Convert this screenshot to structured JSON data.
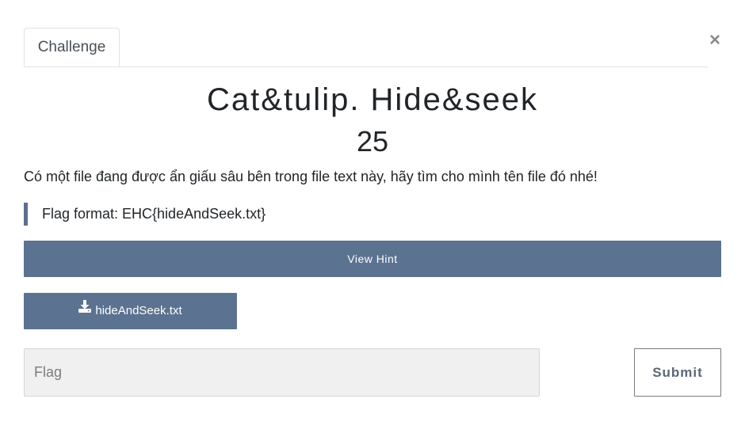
{
  "tabs": [
    {
      "label": "Challenge",
      "active": true
    }
  ],
  "close": {
    "symbol": "×"
  },
  "challenge": {
    "name": "Cat&tulip. Hide&seek",
    "points": "25",
    "description": "Có một file đang được ẩn giấu sâu bên trong file text này, hãy tìm cho mình tên file đó nhé!",
    "flag_format": "Flag format: EHC{hideAndSeek.txt}"
  },
  "buttons": {
    "hint_label": "View Hint",
    "file_label": "hideAndSeek.txt",
    "file_icon": "download-icon",
    "submit_label": "Submit"
  },
  "flag_input": {
    "value": "",
    "placeholder": "Flag"
  },
  "colors": {
    "button_bg": "#5b7290",
    "quote_bar": "#5c6f8e",
    "input_bg": "#f0f0f0"
  }
}
